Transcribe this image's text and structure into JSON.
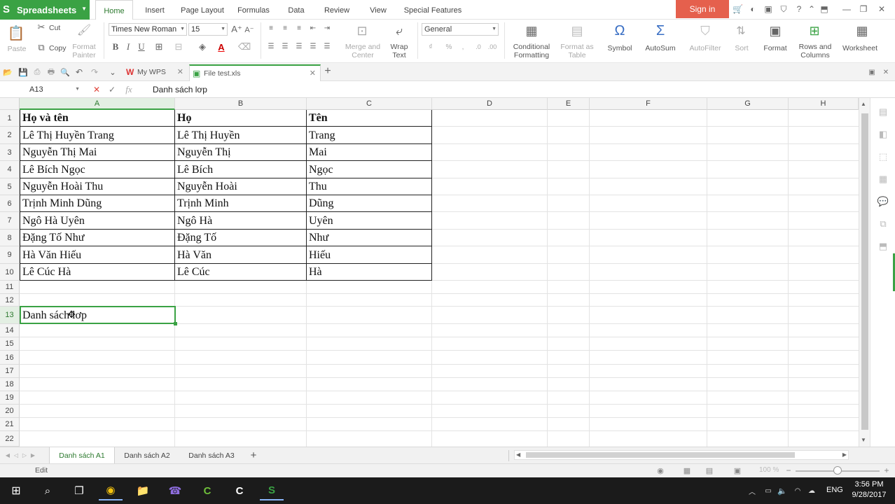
{
  "app": {
    "name": "Spreadsheets",
    "sign_in": "Sign in"
  },
  "menu": {
    "tabs": [
      "Home",
      "Insert",
      "Page Layout",
      "Formulas",
      "Data",
      "Review",
      "View",
      "Special Features"
    ]
  },
  "ribbon": {
    "paste": "Paste",
    "cut": "Cut",
    "copy": "Copy",
    "format_painter_1": "Format",
    "format_painter_2": "Painter",
    "font_name": "Times New Roman",
    "font_size": "15",
    "bold": "B",
    "italic": "I",
    "underline": "U",
    "merge_1": "Merge and",
    "merge_2": "Center",
    "wrap_1": "Wrap",
    "wrap_2": "Text",
    "number_format": "General",
    "cond_1": "Conditional",
    "cond_2": "Formatting",
    "fmt_table_1": "Format as",
    "fmt_table_2": "Table",
    "symbol": "Symbol",
    "autosum": "AutoSum",
    "autofilter": "AutoFilter",
    "sort": "Sort",
    "format": "Format",
    "rows_cols_1": "Rows and",
    "rows_cols_2": "Columns",
    "worksheet": "Worksheet"
  },
  "doc_tabs": {
    "wps": "My WPS",
    "file": "File test.xls"
  },
  "formula_bar": {
    "cell_ref": "A13",
    "fx": "fx",
    "content": "Danh sách lơp"
  },
  "columns": [
    "A",
    "B",
    "C",
    "D",
    "E",
    "F",
    "G",
    "H"
  ],
  "rows": [
    "1",
    "2",
    "3",
    "4",
    "5",
    "6",
    "7",
    "8",
    "9",
    "10",
    "11",
    "12",
    "13",
    "14",
    "15",
    "16",
    "17",
    "18",
    "19",
    "20",
    "21",
    "22"
  ],
  "table": {
    "header": [
      "Họ và tên",
      "Họ",
      "Tên"
    ],
    "rows": [
      [
        "Lê Thị Huyền Trang",
        "Lê Thị Huyền",
        "Trang"
      ],
      [
        "Nguyễn Thị Mai",
        "Nguyễn Thị",
        "Mai"
      ],
      [
        "Lê Bích Ngọc",
        "Lê Bích",
        "Ngọc"
      ],
      [
        "Nguyễn Hoài Thu",
        "Nguyễn Hoài",
        "Thu"
      ],
      [
        "Trịnh Minh Dũng",
        "Trịnh Minh",
        "Dũng"
      ],
      [
        "Ngô Hà Uyên",
        "Ngô Hà",
        "Uyên"
      ],
      [
        "Đặng Tố Như",
        "Đặng Tố",
        "Như"
      ],
      [
        "Hà Văn Hiếu",
        "Hà Văn",
        "Hiếu"
      ],
      [
        "Lê Cúc Hà",
        "Lê Cúc",
        "Hà"
      ]
    ]
  },
  "active_cell_text": "Danh sách lơp",
  "sheets": [
    "Danh sách A1",
    "Danh sách A2",
    "Danh sách A3"
  ],
  "status": {
    "mode": "Edit",
    "zoom": "100 %"
  },
  "taskbar": {
    "lang": "ENG",
    "time": "3:56 PM",
    "date": "9/28/2017"
  },
  "colors": {
    "accent": "#3aa244",
    "sign_in": "#e5604d"
  }
}
